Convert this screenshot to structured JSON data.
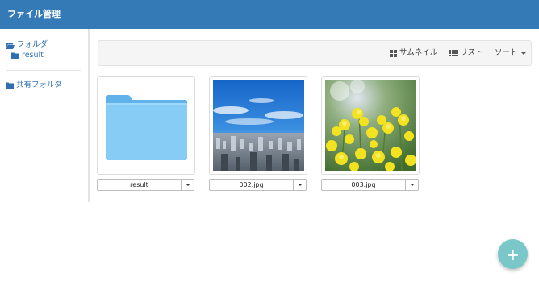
{
  "app": {
    "title": "ファイル管理"
  },
  "sidebar": {
    "items": [
      {
        "label": "フォルダ",
        "icon": "folder-open-icon"
      },
      {
        "label": "result",
        "icon": "folder-icon"
      },
      {
        "label": "共有フォルダ",
        "icon": "folder-icon"
      }
    ]
  },
  "toolbar": {
    "thumbnail_label": "サムネイル",
    "list_label": "リスト",
    "sort_label": "ソート"
  },
  "files": [
    {
      "name": "result",
      "type": "folder"
    },
    {
      "name": "002.jpg",
      "type": "image"
    },
    {
      "name": "003.jpg",
      "type": "image"
    }
  ],
  "fab": {
    "label": "+"
  },
  "colors": {
    "header": "#337ab7",
    "link": "#2f6fb0",
    "fab": "#79c7c9",
    "folder": "#7cc6f2"
  }
}
